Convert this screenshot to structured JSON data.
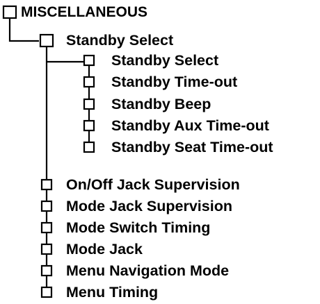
{
  "root": {
    "label": "MISCELLANEOUS"
  },
  "standby_group": {
    "label": "Standby Select",
    "children": [
      "Standby Select",
      "Standby Time-out",
      "Standby Beep",
      "Standby Aux Time-out",
      "Standby Seat Time-out"
    ]
  },
  "items": [
    "On/Off Jack Supervision",
    "Mode Jack Supervision",
    "Mode Switch Timing",
    "Mode Jack",
    "Menu Navigation Mode",
    "Menu Timing"
  ],
  "colors": {
    "line": "#000000",
    "box_fill": "#ffffff",
    "text": "#000000"
  }
}
